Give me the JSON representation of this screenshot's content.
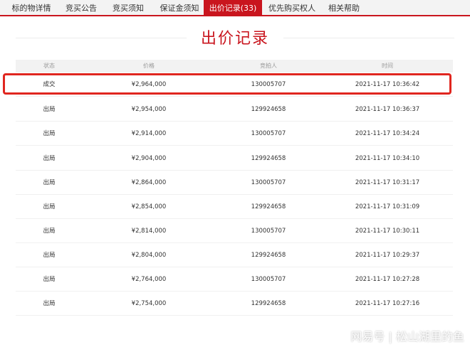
{
  "tabs": [
    {
      "label": "标的物详情"
    },
    {
      "label": "竞买公告"
    },
    {
      "label": "竞买须知"
    },
    {
      "label": "保证金须知"
    },
    {
      "label": "出价记录(33)"
    },
    {
      "label": "优先购买权人"
    },
    {
      "label": "相关帮助"
    }
  ],
  "page_title": "出价记录",
  "table": {
    "headers": {
      "status": "状态",
      "price": "价格",
      "bidder": "竞拍人",
      "time": "时间"
    },
    "rows": [
      {
        "status": "成交",
        "price": "¥2,964,000",
        "bidder": "130005707",
        "time": "2021-11-17 10:36:42"
      },
      {
        "status": "出局",
        "price": "¥2,954,000",
        "bidder": "129924658",
        "time": "2021-11-17 10:36:37"
      },
      {
        "status": "出局",
        "price": "¥2,914,000",
        "bidder": "130005707",
        "time": "2021-11-17 10:34:24"
      },
      {
        "status": "出局",
        "price": "¥2,904,000",
        "bidder": "129924658",
        "time": "2021-11-17 10:34:10"
      },
      {
        "status": "出局",
        "price": "¥2,864,000",
        "bidder": "130005707",
        "time": "2021-11-17 10:31:17"
      },
      {
        "status": "出局",
        "price": "¥2,854,000",
        "bidder": "129924658",
        "time": "2021-11-17 10:31:09"
      },
      {
        "status": "出局",
        "price": "¥2,814,000",
        "bidder": "130005707",
        "time": "2021-11-17 10:30:11"
      },
      {
        "status": "出局",
        "price": "¥2,804,000",
        "bidder": "129924658",
        "time": "2021-11-17 10:29:37"
      },
      {
        "status": "出局",
        "price": "¥2,764,000",
        "bidder": "130005707",
        "time": "2021-11-17 10:27:28"
      },
      {
        "status": "出局",
        "price": "¥2,754,000",
        "bidder": "129924658",
        "time": "2021-11-17 10:27:16"
      }
    ]
  },
  "watermark": "网易号 | 松山湖里的鱼",
  "colors": {
    "accent": "#c9151e",
    "highlight_border": "#e0261f"
  }
}
